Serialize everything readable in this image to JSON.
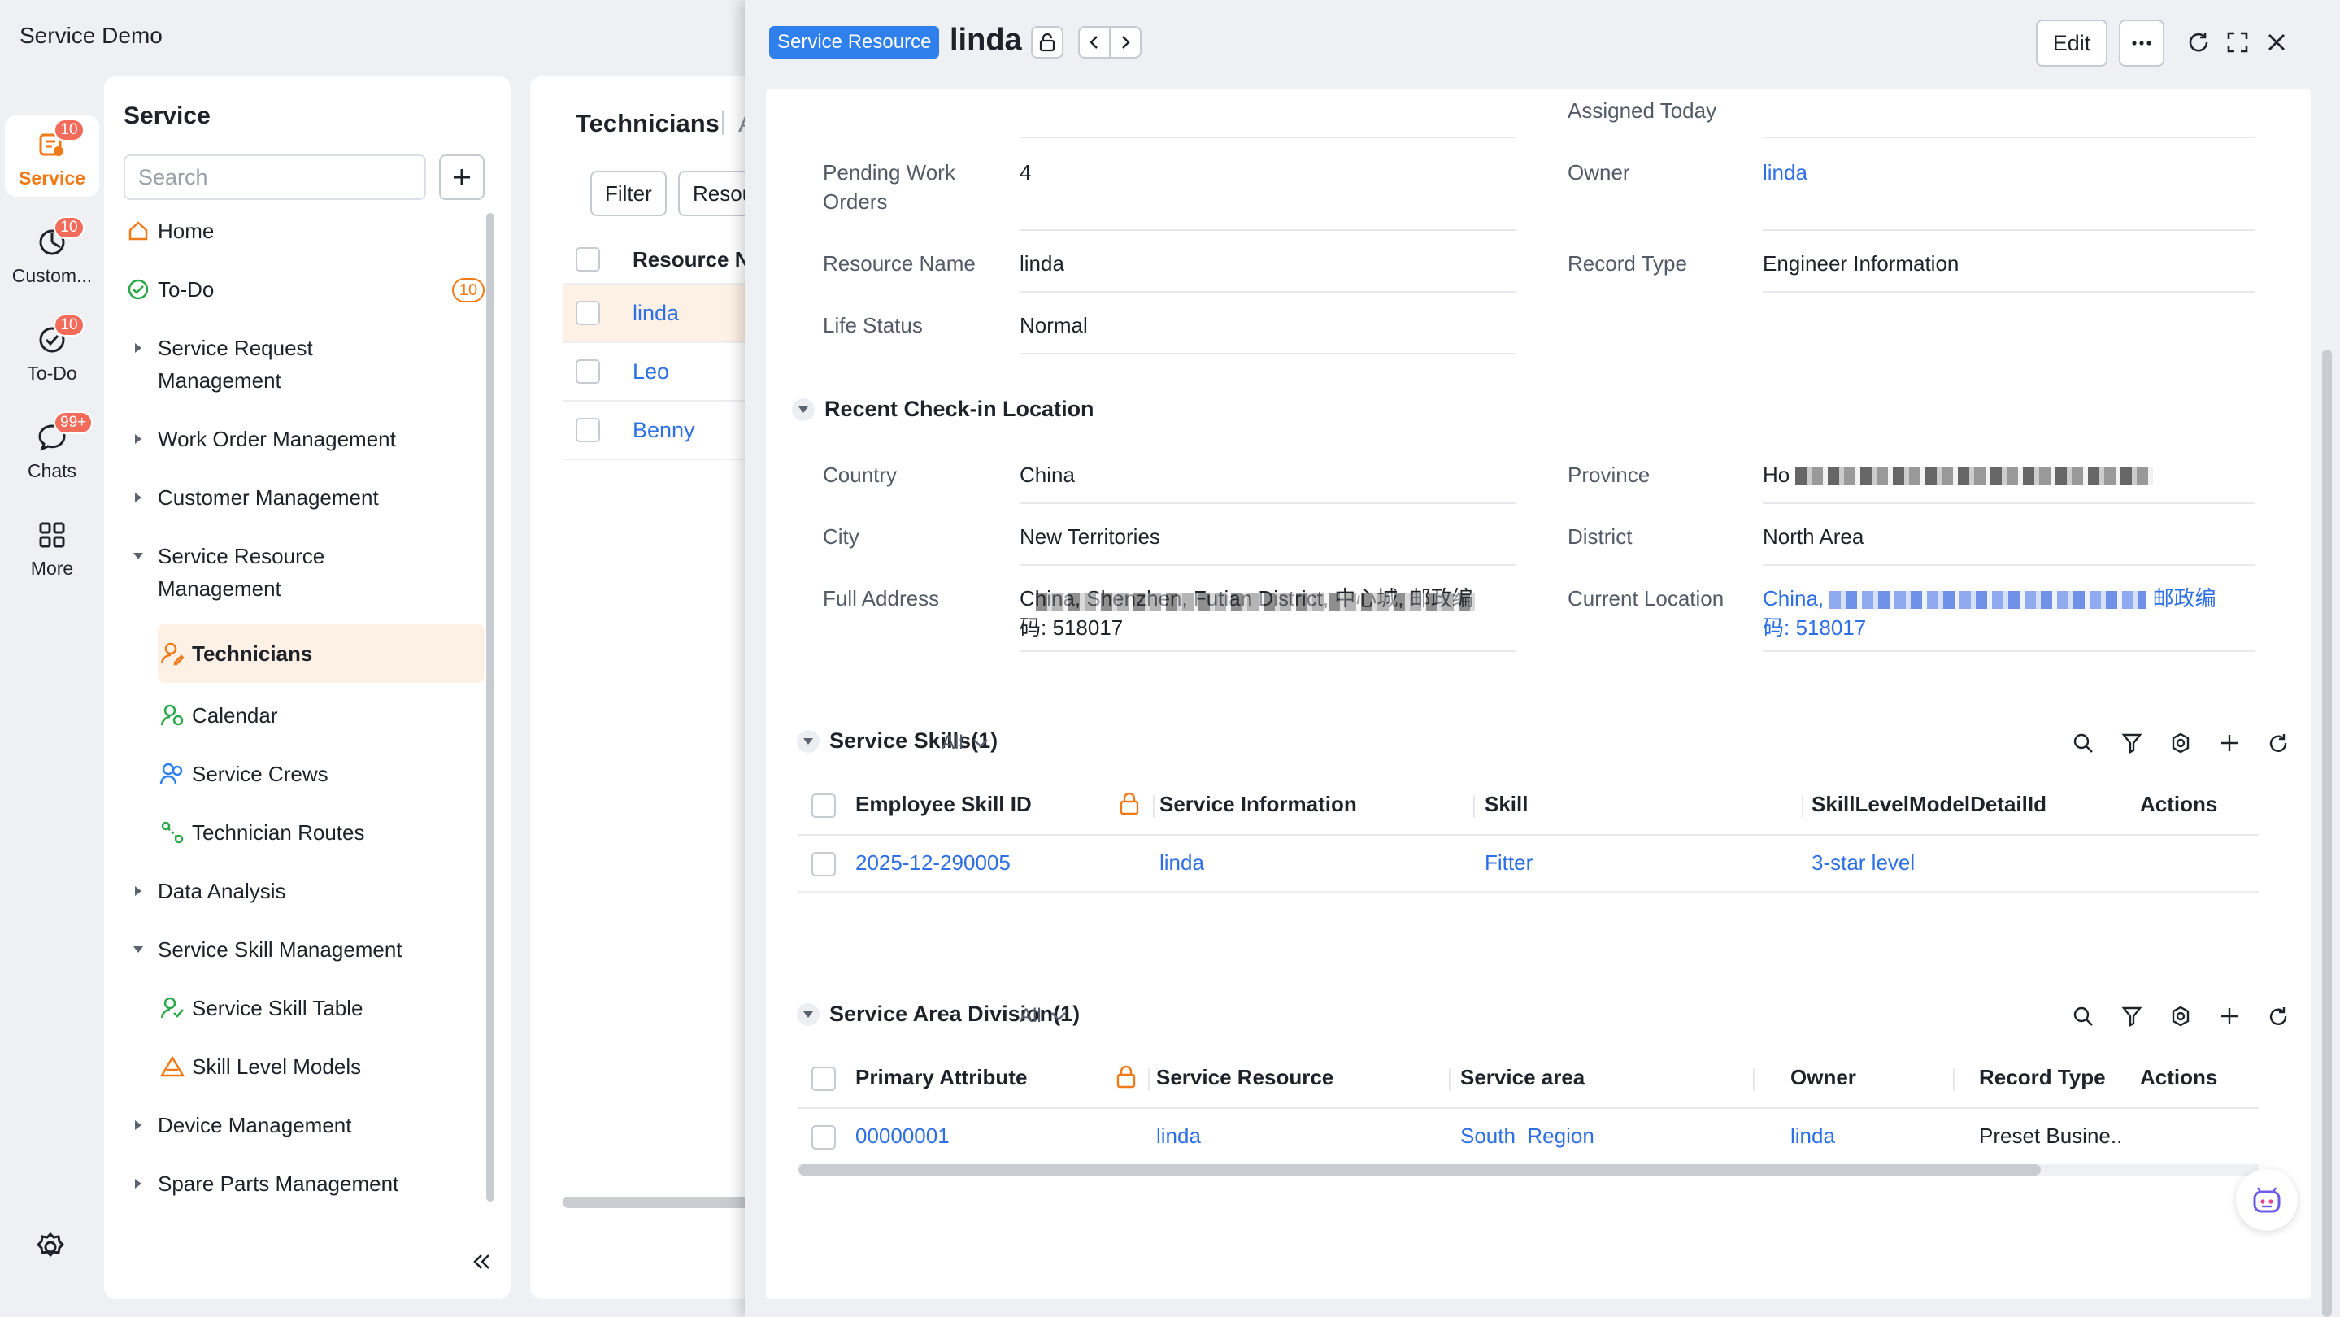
{
  "app": {
    "title": "Service Demo"
  },
  "rail": {
    "items": [
      {
        "label": "Service",
        "badge": "10",
        "icon": "service-icon",
        "active": true
      },
      {
        "label": "Custom...",
        "badge": "10",
        "icon": "customer-icon"
      },
      {
        "label": "To-Do",
        "badge": "10",
        "icon": "todo-icon"
      },
      {
        "label": "Chats",
        "badge": "99+",
        "icon": "chat-icon"
      },
      {
        "label": "More",
        "icon": "grid-icon"
      }
    ],
    "settings_icon": "gear-icon"
  },
  "nav": {
    "title": "Service",
    "search_placeholder": "Search",
    "items": [
      {
        "label": "Home",
        "icon": "home-icon"
      },
      {
        "label": "To-Do",
        "icon": "check-circle-icon",
        "count": "10"
      },
      {
        "label": "Service Request Management",
        "line1": "Service Request",
        "line2": "Management",
        "expandable": true
      },
      {
        "label": "Work Order Management",
        "expandable": true
      },
      {
        "label": "Customer Management",
        "expandable": true
      },
      {
        "label": "Service Resource Management",
        "line1": "Service Resource",
        "line2": "Management",
        "expanded": true
      },
      {
        "label": "Technicians",
        "icon": "technician-icon",
        "selected": true,
        "sub": true
      },
      {
        "label": "Calendar",
        "icon": "calendar-pin-icon",
        "sub": true
      },
      {
        "label": "Service Crews",
        "icon": "crew-icon",
        "sub": true
      },
      {
        "label": "Technician Routes",
        "icon": "route-icon",
        "sub": true
      },
      {
        "label": "Data Analysis",
        "expandable": true
      },
      {
        "label": "Service Skill Management",
        "expanded": true
      },
      {
        "label": "Service Skill Table",
        "icon": "skill-table-icon",
        "sub": true
      },
      {
        "label": "Skill Level Models",
        "icon": "triangle-icon",
        "sub": true
      },
      {
        "label": "Device Management",
        "expandable": true
      },
      {
        "label": "Spare Parts Management",
        "expandable": true
      }
    ]
  },
  "list": {
    "title": "Technicians",
    "title_more": "A",
    "filter_label": "Filter",
    "resource_label": "Resour",
    "column_header": "Resource N",
    "rows": [
      "linda",
      "Leo",
      "Benny"
    ]
  },
  "drawer": {
    "tag": "Service Resource",
    "record_name": "linda",
    "edit_label": "Edit",
    "fields_top": {
      "assigned_today_label": "Assigned Today",
      "pending_label_1": "Pending Work",
      "pending_label_2": "Orders",
      "pending_value": "4",
      "owner_label": "Owner",
      "owner_value": "linda",
      "resource_name_label": "Resource Name",
      "resource_name_value": "linda",
      "record_type_label": "Record Type",
      "record_type_value": "Engineer Information",
      "life_status_label": "Life Status",
      "life_status_value": "Normal"
    },
    "checkin": {
      "section_title": "Recent Check-in Location",
      "country_label": "Country",
      "country_value": "China",
      "province_label": "Province",
      "province_value": "Ho",
      "city_label": "City",
      "city_value": "New Territories",
      "district_label": "District",
      "district_value": "North Area",
      "full_address_label": "Full Address",
      "full_address_line1": "China, Shenzhen, Futian District, 中心城, 邮政编",
      "full_address_line2": "码: 518017",
      "current_location_label": "Current Location",
      "current_location_line1_start": "China,",
      "current_location_line1_end": "邮政编",
      "current_location_line2": "码: 518017"
    },
    "skills": {
      "section_title": "Service Skills(1)",
      "filter": "All",
      "columns": [
        "Employee Skill ID",
        "Service Information",
        "Skill",
        "SkillLevelModelDetailId",
        "Actions"
      ],
      "rows": [
        {
          "id": "2025-12-290005",
          "service_information": "linda",
          "skill": "Fitter",
          "level": "3-star level"
        }
      ]
    },
    "area": {
      "section_title": "Service Area Division(1)",
      "filter": "All",
      "columns": [
        "Primary Attribute",
        "Service Resource",
        "Service area",
        "Owner",
        "Record Type",
        "Actions"
      ],
      "rows": [
        {
          "primary": "00000001",
          "resource": "linda",
          "area": "South  Region",
          "owner": "linda",
          "record_type": "Preset Busine.."
        }
      ]
    }
  }
}
